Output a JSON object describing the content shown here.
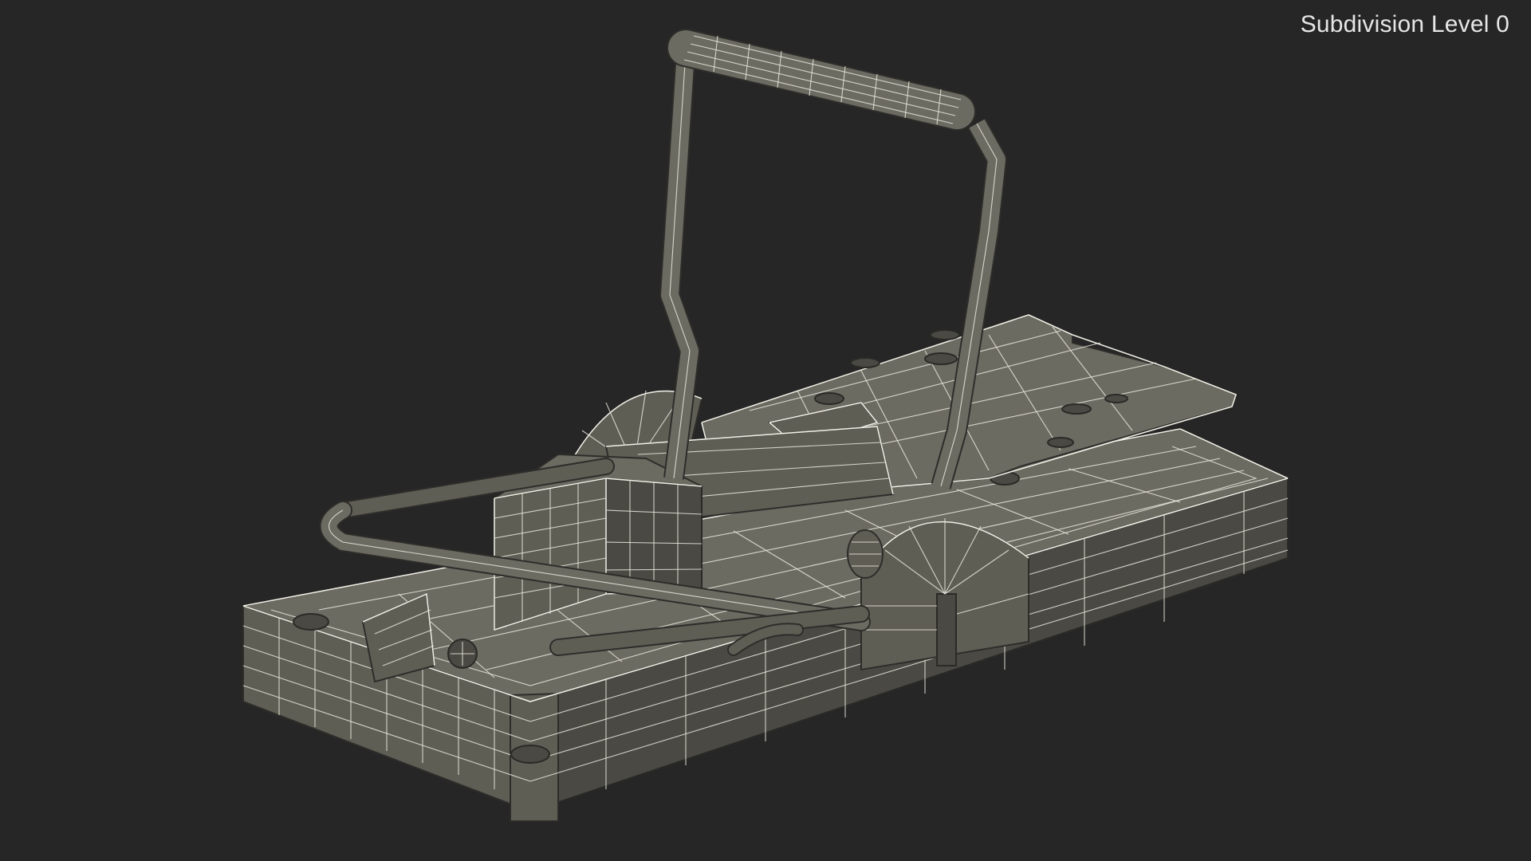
{
  "viewport": {
    "subdivision_label": "Subdivision Level 0",
    "background_color": "#262626",
    "model_color": "#5f5e55",
    "wire_color": "#e9e8dd"
  }
}
